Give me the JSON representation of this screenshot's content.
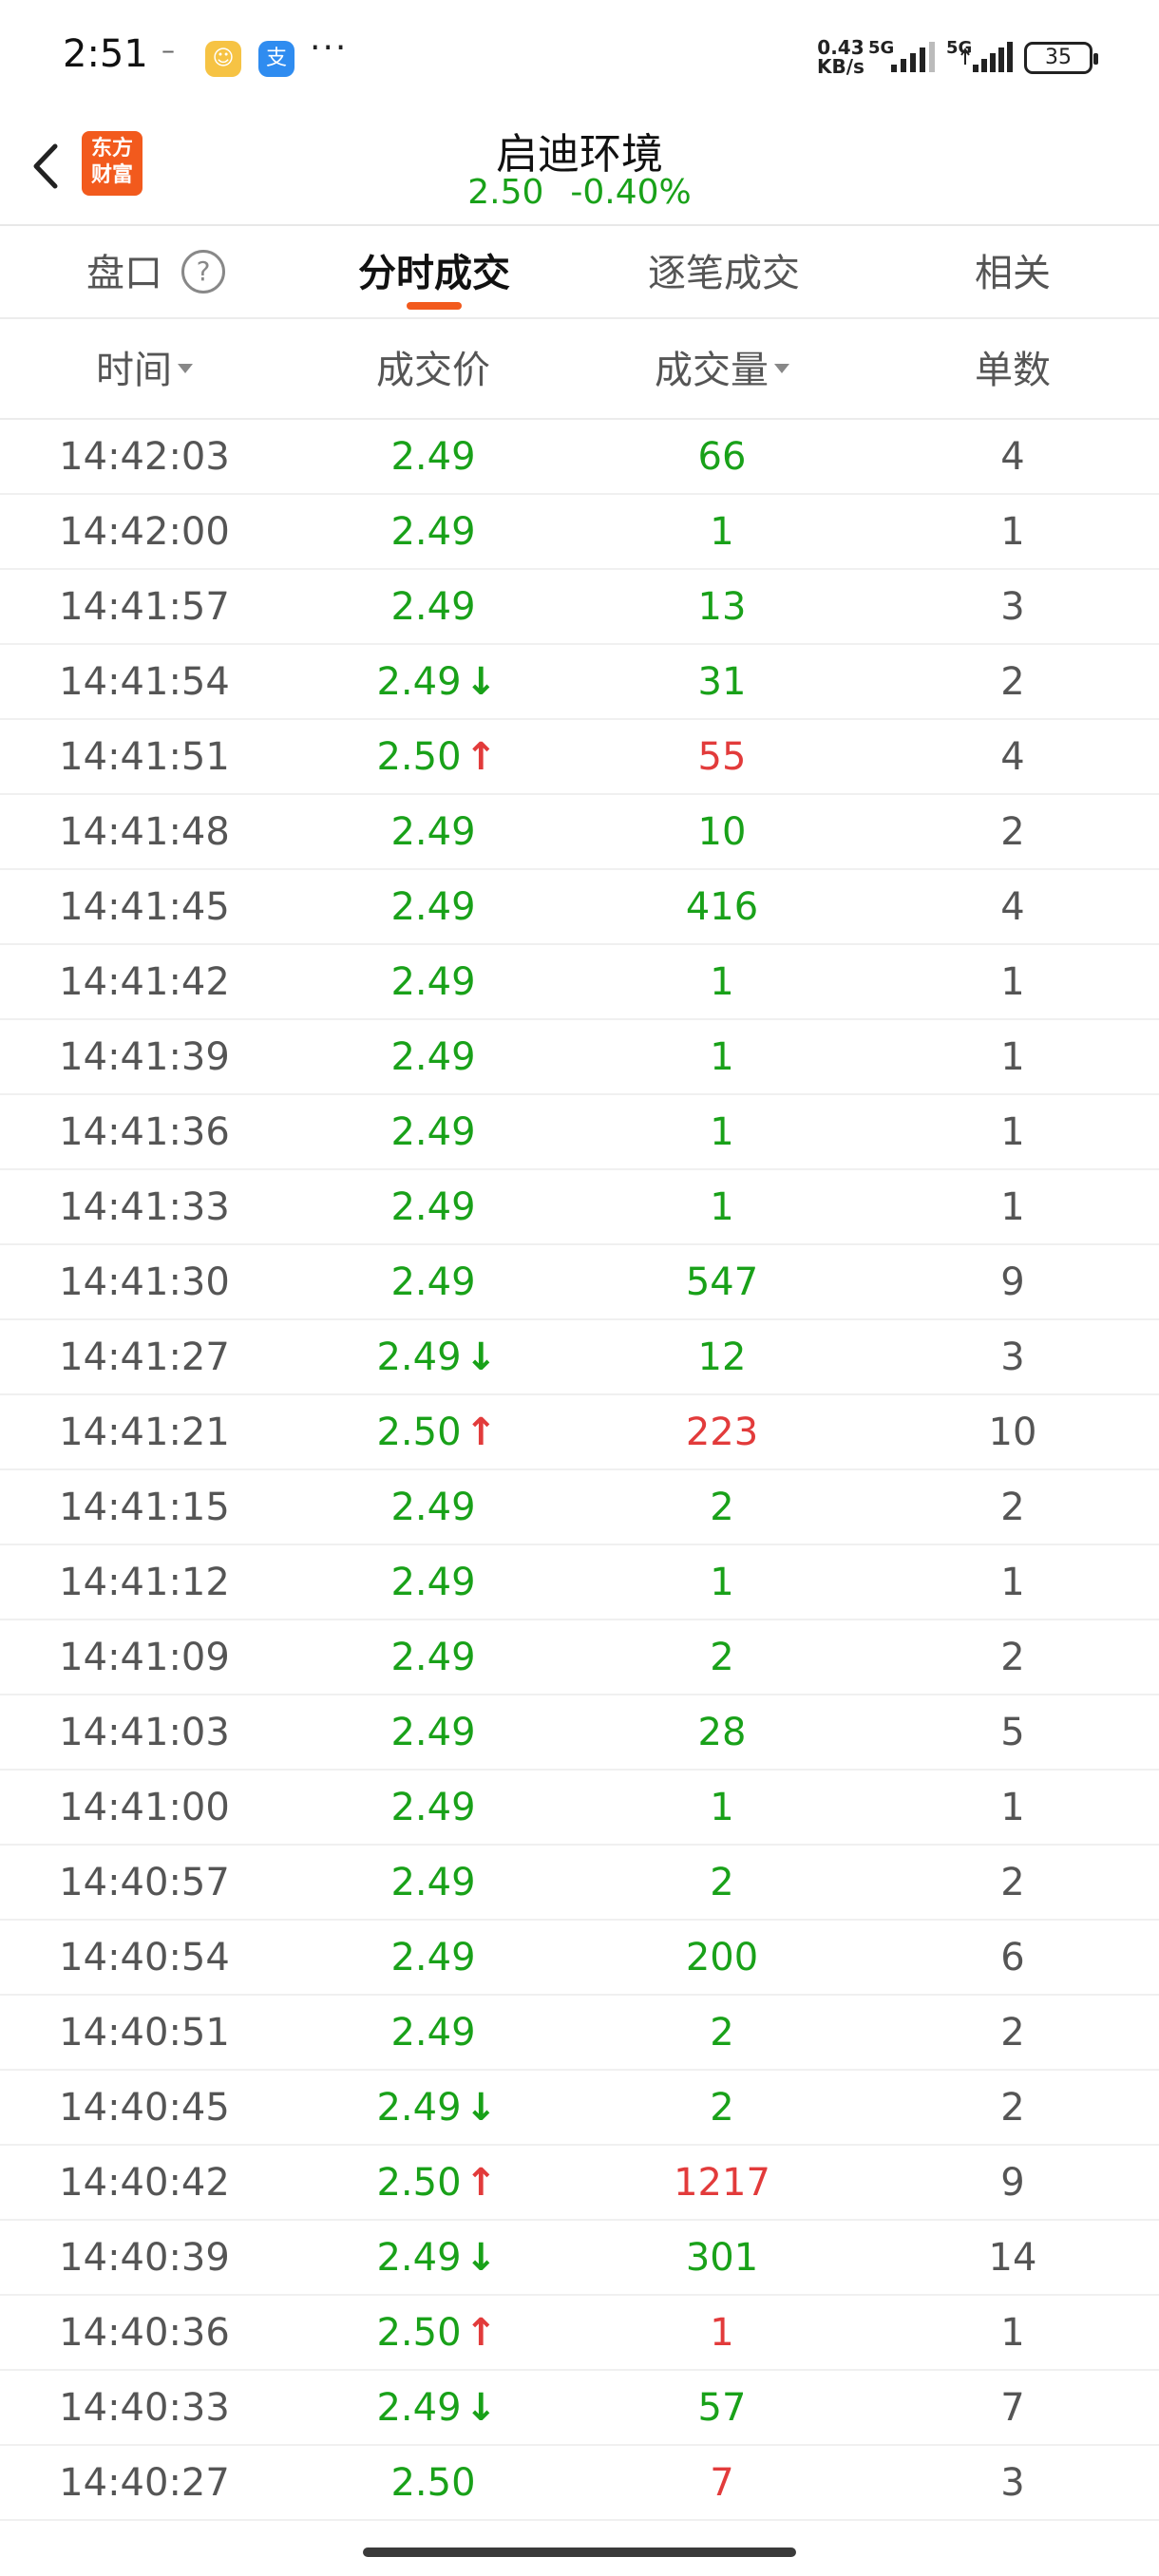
{
  "status_bar": {
    "time": "2:51",
    "dash": "–",
    "speed_value": "0.43",
    "speed_unit": "KB/s",
    "net1": "5G",
    "net2": "5G",
    "battery": "35"
  },
  "header": {
    "logo_line1": "东方",
    "logo_line2": "财富",
    "title": "启迪环境",
    "price": "2.50",
    "change": "-0.40%"
  },
  "tabs": [
    {
      "label": "盘口",
      "active": false
    },
    {
      "label": "分时成交",
      "active": true
    },
    {
      "label": "逐笔成交",
      "active": false
    },
    {
      "label": "相关",
      "active": false
    }
  ],
  "columns": {
    "time": "时间",
    "price": "成交价",
    "volume": "成交量",
    "count": "单数"
  },
  "colors": {
    "up": "#e23b3b",
    "down": "#19a119",
    "accent": "#f25a1d"
  },
  "trades": [
    {
      "time": "14:42:03",
      "price": "2.49",
      "dir": "",
      "volume": "66",
      "vol_color": "green",
      "count": "4"
    },
    {
      "time": "14:42:00",
      "price": "2.49",
      "dir": "",
      "volume": "1",
      "vol_color": "green",
      "count": "1"
    },
    {
      "time": "14:41:57",
      "price": "2.49",
      "dir": "",
      "volume": "13",
      "vol_color": "green",
      "count": "3"
    },
    {
      "time": "14:41:54",
      "price": "2.49",
      "dir": "down",
      "volume": "31",
      "vol_color": "green",
      "count": "2"
    },
    {
      "time": "14:41:51",
      "price": "2.50",
      "dir": "up",
      "volume": "55",
      "vol_color": "red",
      "count": "4"
    },
    {
      "time": "14:41:48",
      "price": "2.49",
      "dir": "",
      "volume": "10",
      "vol_color": "green",
      "count": "2"
    },
    {
      "time": "14:41:45",
      "price": "2.49",
      "dir": "",
      "volume": "416",
      "vol_color": "green",
      "count": "4"
    },
    {
      "time": "14:41:42",
      "price": "2.49",
      "dir": "",
      "volume": "1",
      "vol_color": "green",
      "count": "1"
    },
    {
      "time": "14:41:39",
      "price": "2.49",
      "dir": "",
      "volume": "1",
      "vol_color": "green",
      "count": "1"
    },
    {
      "time": "14:41:36",
      "price": "2.49",
      "dir": "",
      "volume": "1",
      "vol_color": "green",
      "count": "1"
    },
    {
      "time": "14:41:33",
      "price": "2.49",
      "dir": "",
      "volume": "1",
      "vol_color": "green",
      "count": "1"
    },
    {
      "time": "14:41:30",
      "price": "2.49",
      "dir": "",
      "volume": "547",
      "vol_color": "green",
      "count": "9"
    },
    {
      "time": "14:41:27",
      "price": "2.49",
      "dir": "down",
      "volume": "12",
      "vol_color": "green",
      "count": "3"
    },
    {
      "time": "14:41:21",
      "price": "2.50",
      "dir": "up",
      "volume": "223",
      "vol_color": "red",
      "count": "10"
    },
    {
      "time": "14:41:15",
      "price": "2.49",
      "dir": "",
      "volume": "2",
      "vol_color": "green",
      "count": "2"
    },
    {
      "time": "14:41:12",
      "price": "2.49",
      "dir": "",
      "volume": "1",
      "vol_color": "green",
      "count": "1"
    },
    {
      "time": "14:41:09",
      "price": "2.49",
      "dir": "",
      "volume": "2",
      "vol_color": "green",
      "count": "2"
    },
    {
      "time": "14:41:03",
      "price": "2.49",
      "dir": "",
      "volume": "28",
      "vol_color": "green",
      "count": "5"
    },
    {
      "time": "14:41:00",
      "price": "2.49",
      "dir": "",
      "volume": "1",
      "vol_color": "green",
      "count": "1"
    },
    {
      "time": "14:40:57",
      "price": "2.49",
      "dir": "",
      "volume": "2",
      "vol_color": "green",
      "count": "2"
    },
    {
      "time": "14:40:54",
      "price": "2.49",
      "dir": "",
      "volume": "200",
      "vol_color": "green",
      "count": "6"
    },
    {
      "time": "14:40:51",
      "price": "2.49",
      "dir": "",
      "volume": "2",
      "vol_color": "green",
      "count": "2"
    },
    {
      "time": "14:40:45",
      "price": "2.49",
      "dir": "down",
      "volume": "2",
      "vol_color": "green",
      "count": "2"
    },
    {
      "time": "14:40:42",
      "price": "2.50",
      "dir": "up",
      "volume": "1217",
      "vol_color": "red",
      "count": "9"
    },
    {
      "time": "14:40:39",
      "price": "2.49",
      "dir": "down",
      "volume": "301",
      "vol_color": "green",
      "count": "14"
    },
    {
      "time": "14:40:36",
      "price": "2.50",
      "dir": "up",
      "volume": "1",
      "vol_color": "red",
      "count": "1"
    },
    {
      "time": "14:40:33",
      "price": "2.49",
      "dir": "down",
      "volume": "57",
      "vol_color": "green",
      "count": "7"
    },
    {
      "time": "14:40:27",
      "price": "2.50",
      "dir": "",
      "volume": "7",
      "vol_color": "red",
      "count": "3"
    }
  ]
}
